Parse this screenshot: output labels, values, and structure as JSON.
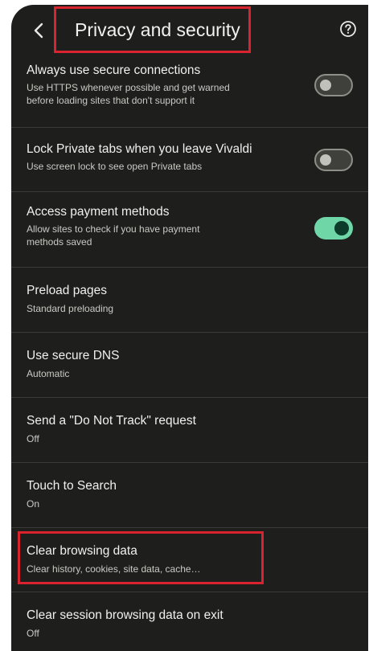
{
  "header": {
    "title": "Privacy and security",
    "back_icon": "chevron-left-icon",
    "help_icon": "help-circle-icon"
  },
  "colors": {
    "background": "#1e1f1d",
    "toggle_on": "#6fd6a8",
    "highlight": "#d9232f"
  },
  "settings": [
    {
      "title": "Always use secure connections",
      "sub1": "Use HTTPS whenever possible and get warned",
      "sub2": "before loading sites that don't support it",
      "toggle": "off"
    },
    {
      "title": "Lock Private tabs when you leave Vivaldi",
      "sub1": "Use screen lock to see open Private tabs",
      "toggle": "off"
    },
    {
      "title": "Access payment methods",
      "sub1": "Allow sites to check if you have payment",
      "sub2": "methods saved",
      "toggle": "on"
    },
    {
      "title": "Preload pages",
      "sub1": "Standard preloading"
    },
    {
      "title": "Use secure DNS",
      "sub1": "Automatic"
    },
    {
      "title": "Send a \"Do Not Track\" request",
      "sub1": "Off"
    },
    {
      "title": "Touch to Search",
      "sub1": "On"
    },
    {
      "title": "Clear browsing data",
      "sub1": "Clear history, cookies, site data, cache…"
    },
    {
      "title": "Clear session browsing data on exit",
      "sub1": "Off"
    }
  ]
}
